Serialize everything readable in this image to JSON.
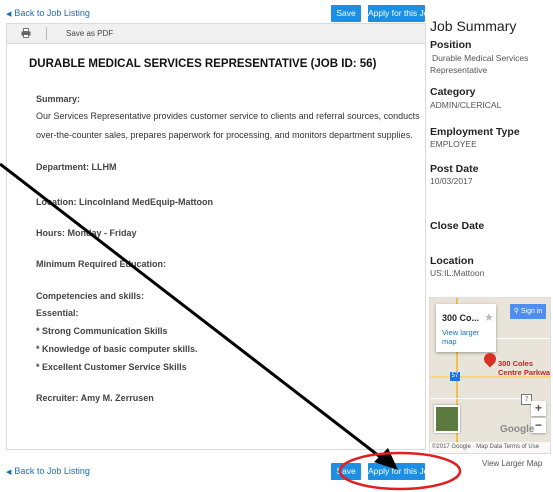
{
  "nav": {
    "back_top": "Back to Job Listing",
    "back_bottom": "Back to Job Listing"
  },
  "actions": {
    "save_label": "Save",
    "apply_top": "Apply for this Job",
    "apply_bottom": "Apply for this Job"
  },
  "toolbar": {
    "print_icon": "printer-icon",
    "save_pdf": "Save as PDF"
  },
  "job": {
    "title": "DURABLE MEDICAL SERVICES REPRESENTATIVE (JOB ID: 56)",
    "summary_heading": "Summary:",
    "summary_line1": "Our Services Representative provides customer service to clients and referral sources, conducts",
    "summary_line2": "over-the-counter sales, prepares paperwork for processing, and monitors department supplies.",
    "department": "Department: LLHM",
    "location": "Location: Lincolnland MedEquip-Mattoon",
    "hours": "Hours: Monday - Friday",
    "min_education": "Minimum Required Education:",
    "competencies": "Competencies and skills:",
    "essential": "Essential:",
    "skills": [
      "* Strong Communication Skills",
      "* Knowledge of basic computer skills.",
      "* Excellent Customer Service Skills"
    ],
    "recruiter": "Recruiter:  Amy M. Zerrusen"
  },
  "summary": {
    "heading": "Job Summary",
    "position_label": "Position",
    "position_value_line1": "Durable Medical Services",
    "position_value_line2": "Representative",
    "category_label": "Category",
    "category_value": "ADMIN/CLERICAL",
    "employment_label": "Employment Type",
    "employment_value": "EMPLOYEE",
    "postdate_label": "Post Date",
    "postdate_value": "10/03/2017",
    "closedate_label": "Close Date",
    "location_label": "Location",
    "location_value": "US:IL:Mattoon"
  },
  "map": {
    "popup_title": "300 Co...",
    "popup_link_line1": "View larger",
    "popup_link_line2": "map",
    "sign_in": "Sign in",
    "pin_label_line1": "300 Coles",
    "pin_label_line2": "Centre Parkway",
    "route_badge": "57",
    "box_label": "7",
    "zoom_in": "+",
    "zoom_out": "−",
    "google": "Google",
    "footer": "©2017 Google · Map Data    Terms of Use",
    "view_larger": "View Larger Map"
  },
  "colors": {
    "button": "#1b8fe3",
    "link": "#1a6eb5",
    "annotation_circle": "#e02020"
  }
}
